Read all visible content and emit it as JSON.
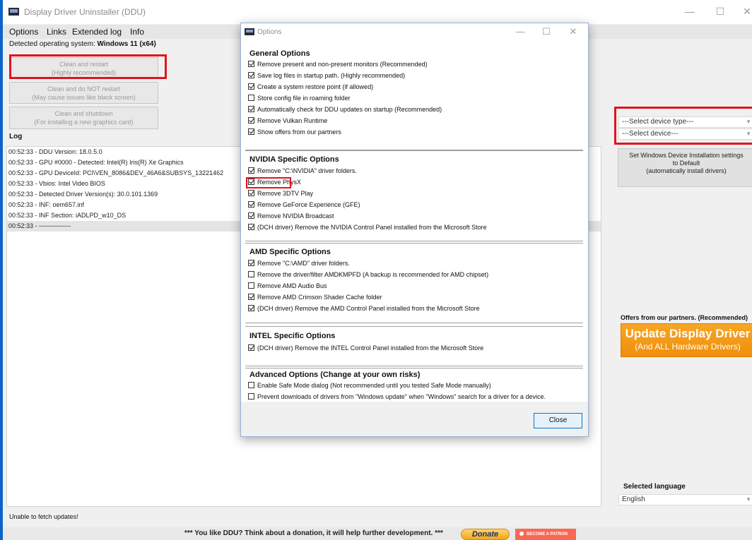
{
  "window": {
    "title": "Display Driver Uninstaller (DDU)",
    "minimize": "—",
    "maximize": "☐",
    "close": "✕"
  },
  "menu": [
    "Options",
    "Links",
    "Extended log",
    "Info"
  ],
  "detected_os": {
    "label": "Detected operating system:",
    "value": "Windows 11 (x64)"
  },
  "buttons": {
    "clean_restart": {
      "line1": "Clean and restart",
      "line2": "(Highly recommended)"
    },
    "clean_no_restart": {
      "line1": "Clean and do NOT restart",
      "line2": "(May cause issues like black screen)"
    },
    "clean_shutdown": {
      "line1": "Clean and shutdown",
      "line2": "(For installing a new graphics card)"
    }
  },
  "log": {
    "label": "Log",
    "lines": [
      "00:52:33 - DDU Version: 18.0.5.0",
      "00:52:33 - GPU #0000 - Detected: Intel(R) Iris(R) Xe Graphics",
      "00:52:33 - GPU DeviceId: PCI\\VEN_8086&DEV_46A6&SUBSYS_13221462",
      "00:52:33 - Vbios: Intel Video BIOS",
      "00:52:33 - Detected Driver Version(s): 30.0.101.1369",
      "00:52:33 - INF: oem657.inf",
      "00:52:33 - INF Section: iADLPD_w10_DS",
      "00:52:33 - ---------------"
    ]
  },
  "right": {
    "device_type": "---Select device type---",
    "device": "---Select device---",
    "set_default": {
      "line1": "Set Windows Device Installation settings",
      "line2": "to Default",
      "line3": "(automatically install drivers)"
    },
    "offers_label": "Offers from our partners. (Recommended)",
    "update": {
      "line1": "Update Display Driver",
      "line2": "(And ALL Hardware Drivers)"
    },
    "language_label": "Selected language",
    "language": "English"
  },
  "status": "Unable to fetch updates!",
  "footer": {
    "message": "*** You like DDU? Think about a donation, it will help further development. ***",
    "donate": "Donate",
    "patron": "BECOME A PATRON"
  },
  "dialog": {
    "title": "Options",
    "close_button": "Close",
    "sections": [
      {
        "header": "General Options",
        "options": [
          {
            "label": "Remove present and non-present monitors (Recommended)",
            "checked": true
          },
          {
            "label": "Save log files in startup path. (Highly recommended)",
            "checked": true
          },
          {
            "label": "Create a system restore point (if allowed)",
            "checked": true
          },
          {
            "label": "Store config file in roaming folder",
            "checked": false
          },
          {
            "label": "Automatically check for DDU updates on startup (Recommended)",
            "checked": true
          },
          {
            "label": "Remove Vulkan Runtime",
            "checked": true
          },
          {
            "label": "Show offers from our partners",
            "checked": true
          }
        ]
      },
      {
        "header": "NVIDIA Specific Options",
        "options": [
          {
            "label": "Remove \"C:\\NVIDIA\" driver folders.",
            "checked": true
          },
          {
            "label": "Remove PhysX",
            "checked": true
          },
          {
            "label": "Remove 3DTV Play",
            "checked": true
          },
          {
            "label": "Remove GeForce Experience (GFE)",
            "checked": true
          },
          {
            "label": "Remove NVIDIA Broadcast",
            "checked": true
          },
          {
            "label": "(DCH driver) Remove the NVIDIA Control Panel installed from the Microsoft Store",
            "checked": true
          }
        ]
      },
      {
        "header": "AMD Specific Options",
        "options": [
          {
            "label": "Remove \"C:\\AMD\" driver folders.",
            "checked": true
          },
          {
            "label": "Remove the driver/filter AMDKMPFD (A backup is recommended for AMD chipset)",
            "checked": false
          },
          {
            "label": "Remove AMD Audio Bus",
            "checked": false
          },
          {
            "label": "Remove AMD Crimson Shader Cache folder",
            "checked": true
          },
          {
            "label": "(DCH driver) Remove the AMD Control Panel installed from the Microsoft Store",
            "checked": true
          }
        ]
      },
      {
        "header": "INTEL Specific Options",
        "options": [
          {
            "label": "(DCH driver) Remove the INTEL Control Panel installed from the Microsoft Store",
            "checked": true
          }
        ]
      },
      {
        "header": "Advanced Options (Change at your own risks)",
        "options": [
          {
            "label": "Enable Safe Mode dialog (Not recommended until you tested Safe Mode manually)",
            "checked": false
          },
          {
            "label": "Prevent downloads of drivers from \"Windows update\" when \"Windows\" search for a driver for a device.",
            "checked": false
          }
        ]
      }
    ]
  }
}
